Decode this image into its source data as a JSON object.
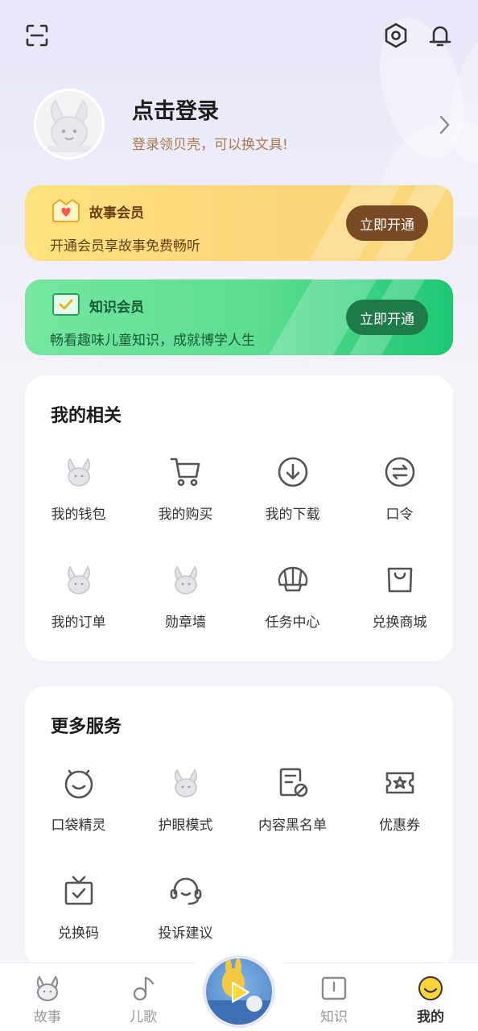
{
  "header": {
    "scan_icon": "scan-icon",
    "settings_icon": "settings-hex-icon",
    "notification_icon": "bell-icon"
  },
  "profile": {
    "title": "点击登录",
    "subtitle": "登录领贝壳，可以换文具!"
  },
  "vip_story": {
    "title": "故事会员",
    "desc": "开通会员享故事免费畅听",
    "button": "立即开通"
  },
  "vip_knowledge": {
    "title": "知识会员",
    "desc": "畅看趣味儿童知识，成就博学人生",
    "button": "立即开通"
  },
  "related": {
    "title": "我的相关",
    "items": [
      {
        "label": "我的钱包",
        "icon": "bunny-icon"
      },
      {
        "label": "我的购买",
        "icon": "cart-icon"
      },
      {
        "label": "我的下载",
        "icon": "download-icon"
      },
      {
        "label": "口令",
        "icon": "exchange-icon"
      },
      {
        "label": "我的订单",
        "icon": "bunny-icon"
      },
      {
        "label": "勋章墙",
        "icon": "bunny-icon"
      },
      {
        "label": "任务中心",
        "icon": "shell-icon"
      },
      {
        "label": "兑换商城",
        "icon": "bag-icon"
      }
    ]
  },
  "more": {
    "title": "更多服务",
    "items": [
      {
        "label": "口袋精灵",
        "icon": "sprite-icon"
      },
      {
        "label": "护眼模式",
        "icon": "bunny-icon"
      },
      {
        "label": "内容黑名单",
        "icon": "blacklist-icon"
      },
      {
        "label": "优惠券",
        "icon": "coupon-icon"
      },
      {
        "label": "兑换码",
        "icon": "gift-code-icon"
      },
      {
        "label": "投诉建议",
        "icon": "headset-icon"
      }
    ]
  },
  "tabbar": {
    "tabs": [
      {
        "label": "故事",
        "icon": "bunny-icon"
      },
      {
        "label": "儿歌",
        "icon": "music-note-icon"
      },
      {
        "label": "知识",
        "icon": "book-icon"
      },
      {
        "label": "我的",
        "icon": "smile-icon"
      }
    ],
    "active": "我的",
    "colors": {
      "active_icon": "#fbd33b",
      "inactive": "#999999"
    }
  },
  "colors": {
    "story_vip": "#fcd57a",
    "knowledge_vip": "#5ddc93",
    "page_bg": "#f4f3f9"
  }
}
